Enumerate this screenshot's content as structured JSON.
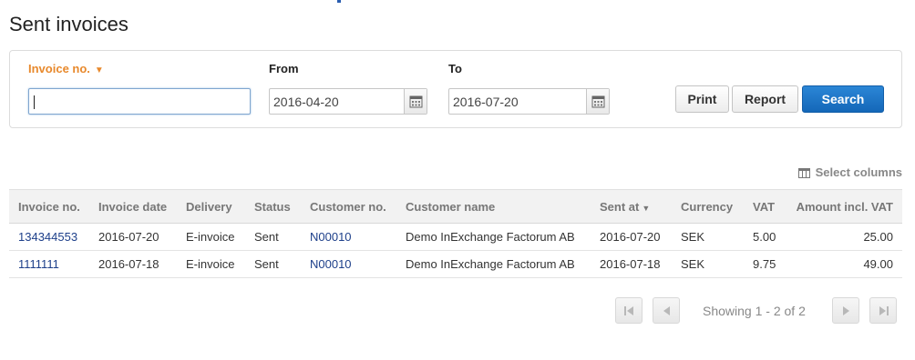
{
  "page": {
    "title": "Sent invoices"
  },
  "filters": {
    "invoice_no_label": "Invoice no.",
    "invoice_no_value": "",
    "from_label": "From",
    "from_value": "2016-04-20",
    "to_label": "To",
    "to_value": "2016-07-20"
  },
  "buttons": {
    "print": "Print",
    "report": "Report",
    "search": "Search"
  },
  "select_columns": "Select columns",
  "table": {
    "columns": [
      "Invoice no.",
      "Invoice date",
      "Delivery",
      "Status",
      "Customer no.",
      "Customer name",
      "Sent at",
      "Currency",
      "VAT",
      "Amount incl. VAT"
    ],
    "rows": [
      [
        "134344553",
        "2016-07-20",
        "E-invoice",
        "Sent",
        "N00010",
        "Demo InExchange Factorum AB",
        "2016-07-20",
        "SEK",
        "5.00",
        "25.00"
      ],
      [
        "1111111",
        "2016-07-18",
        "E-invoice",
        "Sent",
        "N00010",
        "Demo InExchange Factorum AB",
        "2016-07-18",
        "SEK",
        "9.75",
        "49.00"
      ]
    ]
  },
  "pager": {
    "prefix": "Showing ",
    "range": "1 - 2 of 2"
  },
  "colors": {
    "accent_orange": "#e8892c",
    "primary_blue": "#1467b8",
    "link_blue": "#1d3f8a"
  },
  "icons": [
    "calendar-icon",
    "columns-icon",
    "sort-desc-icon",
    "first-page-icon",
    "prev-page-icon",
    "next-page-icon",
    "last-page-icon",
    "dropdown-caret-icon"
  ]
}
